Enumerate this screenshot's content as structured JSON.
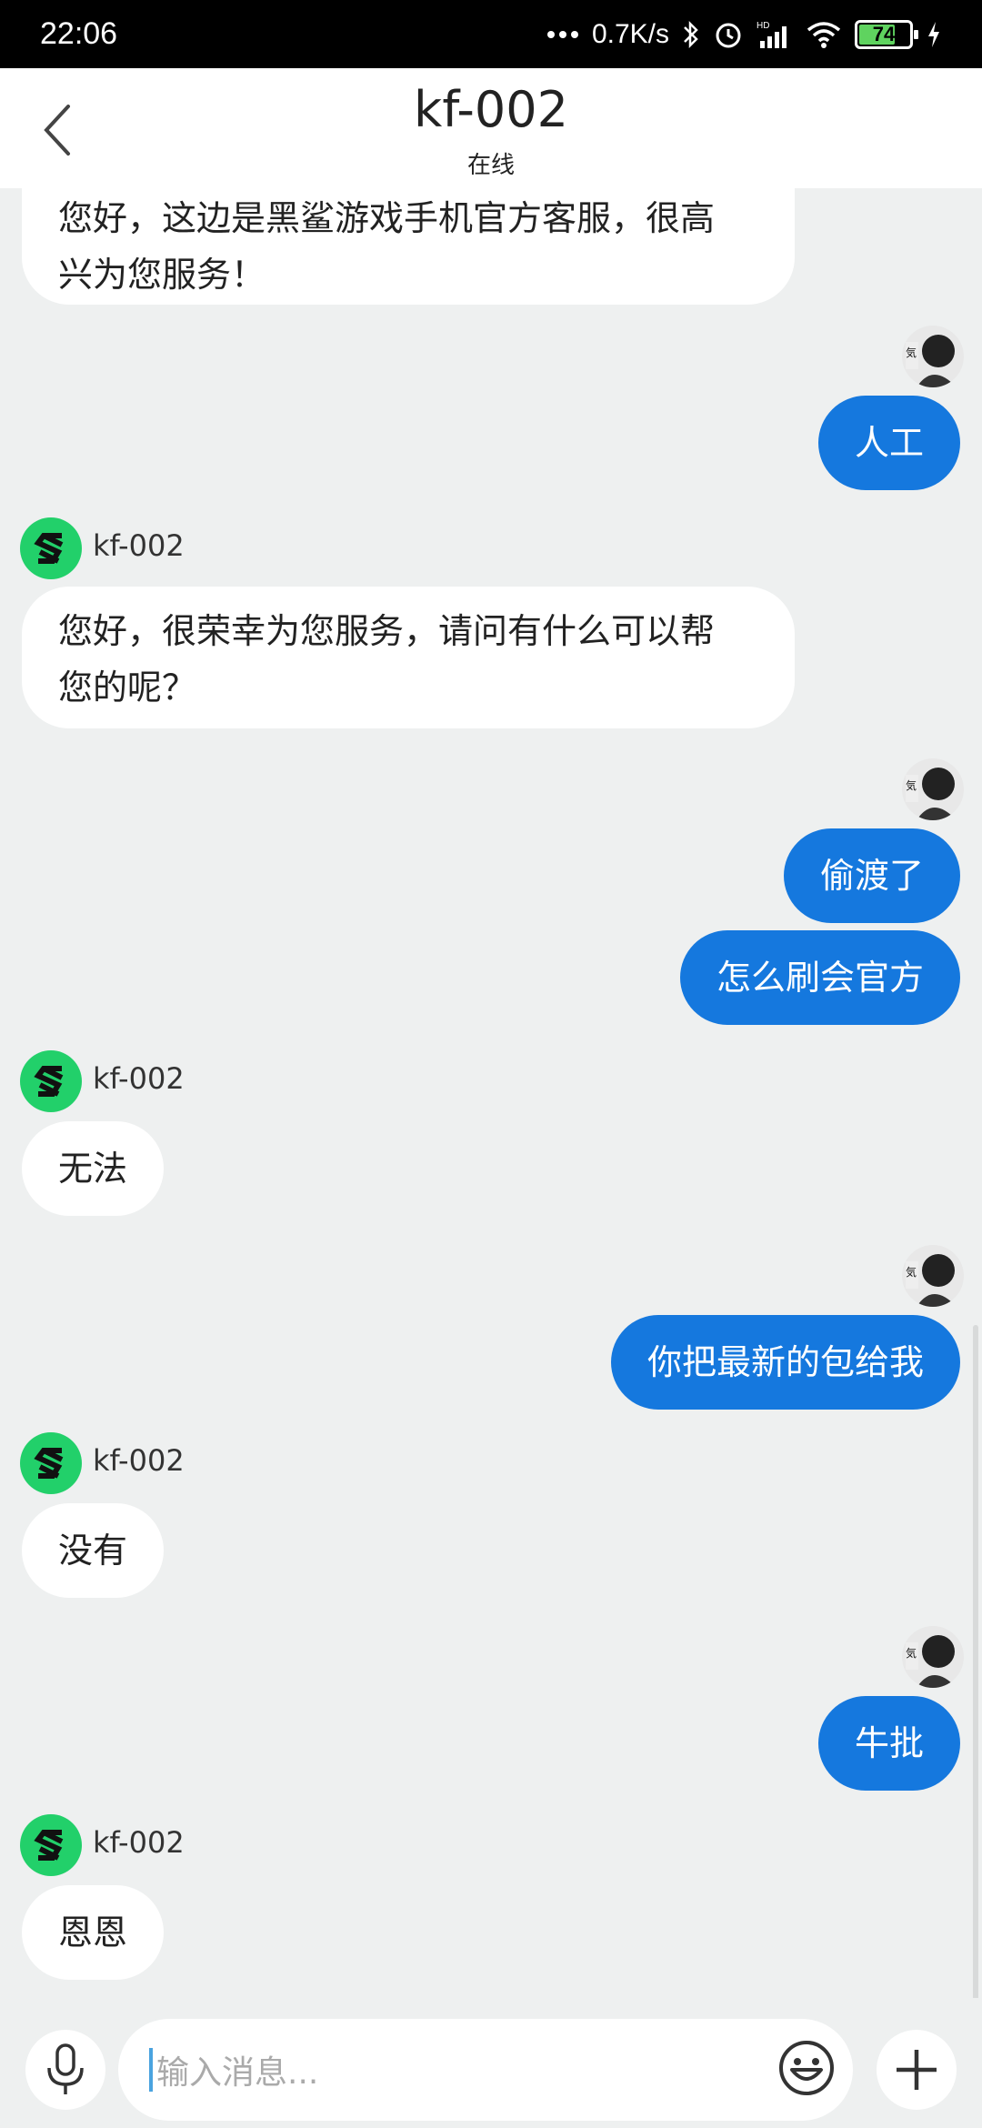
{
  "status_bar": {
    "time": "22:06",
    "net_speed": "0.7K/s",
    "battery_level": "74",
    "battery_fraction": 0.74,
    "icons": [
      "dots-icon",
      "bluetooth-icon",
      "alarm-icon",
      "hd-signal-icon",
      "wifi-icon",
      "battery-icon",
      "charging-icon"
    ]
  },
  "header": {
    "title": "kf-002",
    "subtitle": "在线"
  },
  "agent": {
    "name": "kf-002",
    "avatar_color": "#22d06a"
  },
  "colors": {
    "accent": "#1578de",
    "background": "#eef0f0"
  },
  "messages": [
    {
      "from": "agent",
      "lines": [
        "您好，这边是黑鲨游戏手机官方客服，很高",
        "兴为您服务！"
      ]
    },
    {
      "from": "user",
      "text": "人工"
    },
    {
      "from": "agent",
      "name": "kf-002",
      "lines": [
        "您好，很荣幸为您服务，请问有什么可以帮",
        "您的呢？"
      ]
    },
    {
      "from": "user",
      "text": "偷渡了"
    },
    {
      "from": "user",
      "text": "怎么刷会官方"
    },
    {
      "from": "agent",
      "name": "kf-002",
      "text": "无法"
    },
    {
      "from": "user",
      "text": "你把最新的包给我"
    },
    {
      "from": "agent",
      "name": "kf-002",
      "text": "没有"
    },
    {
      "from": "user",
      "text": "牛批"
    },
    {
      "from": "agent",
      "name": "kf-002",
      "text": "恩恩"
    }
  ],
  "input": {
    "placeholder": "输入消息..."
  }
}
